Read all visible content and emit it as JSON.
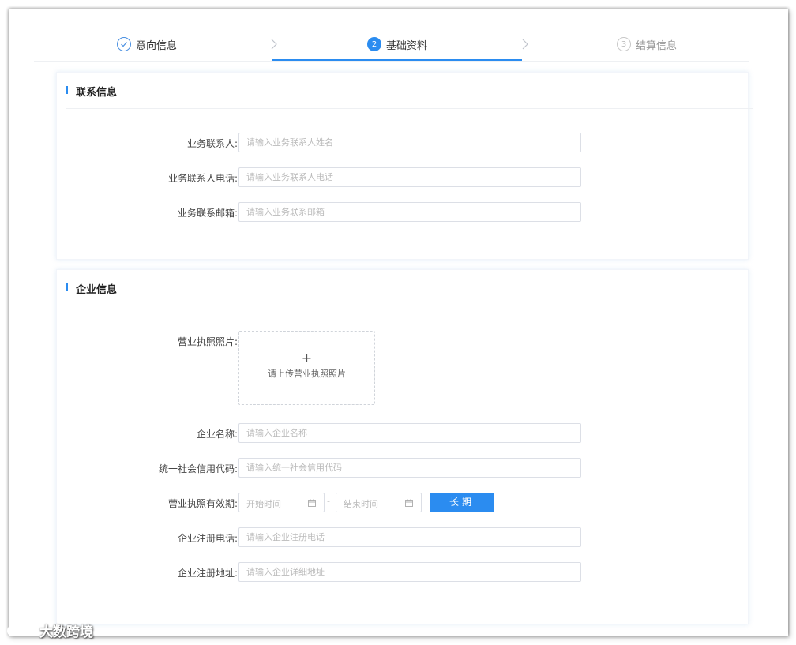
{
  "steps": [
    {
      "label": "意向信息",
      "status": "done",
      "icon": "check-icon"
    },
    {
      "label": "基础资料",
      "number": "2",
      "status": "active"
    },
    {
      "label": "结算信息",
      "number": "3",
      "status": "pending"
    }
  ],
  "contact_section": {
    "title": "联系信息",
    "fields": [
      {
        "label": "业务联系人:",
        "placeholder": "请输入业务联系人姓名",
        "value": ""
      },
      {
        "label": "业务联系人电话:",
        "placeholder": "请输入业务联系人电话",
        "value": ""
      },
      {
        "label": "业务联系邮箱:",
        "placeholder": "请输入业务联系邮箱",
        "value": ""
      }
    ]
  },
  "company_section": {
    "title": "企业信息",
    "license_photo": {
      "label": "营业执照照片:",
      "plus": "+",
      "upload_text": "请上传营业执照照片"
    },
    "name": {
      "label": "企业名称:",
      "placeholder": "请输入企业名称",
      "value": ""
    },
    "credit_code": {
      "label": "统一社会信用代码:",
      "placeholder": "请输入统一社会信用代码",
      "value": ""
    },
    "validity": {
      "label": "营业执照有效期:",
      "start_placeholder": "开始时间",
      "separator": "-",
      "end_placeholder": "结束时间",
      "long_term_button": "长期"
    },
    "phone": {
      "label": "企业注册电话:",
      "placeholder": "请输入企业注册电话",
      "value": ""
    },
    "address": {
      "label": "企业注册地址:",
      "placeholder": "请输入企业详细地址",
      "value": ""
    }
  },
  "watermark": {
    "text": "大数跨境"
  },
  "colors": {
    "accent": "#2b8cf0",
    "border": "#dcdfe6",
    "placeholder": "#bbbbbb"
  }
}
